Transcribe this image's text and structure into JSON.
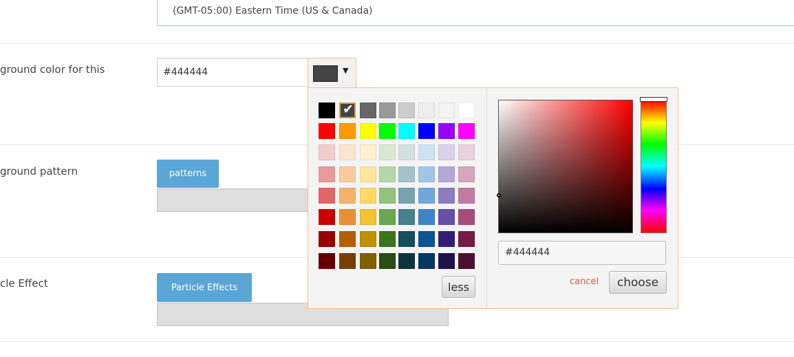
{
  "timezone": {
    "value": "(GMT-05:00) Eastern Time (US & Canada)"
  },
  "rows": {
    "bg_color_label": "ground color for this",
    "bg_pattern_label": "ground pattern",
    "particle_label": "cle Effect"
  },
  "color_field": {
    "value": "#444444",
    "swatch_color": "#444444",
    "caret": "▼"
  },
  "buttons": {
    "patterns": "patterns",
    "particle_effects": "Particle Effects"
  },
  "palette": {
    "selected_color": "#444444",
    "rows": [
      [
        "#000000",
        "#444444",
        "#666666",
        "#999999",
        "#cccccc",
        "#eeeeee",
        "#f3f3f3",
        "#ffffff"
      ],
      [
        "#ff0000",
        "#ff9900",
        "#ffff00",
        "#00ff00",
        "#00ffff",
        "#0000ff",
        "#9900ff",
        "#ff00ff"
      ],
      [
        "#f4cccc",
        "#fce5cd",
        "#fff2cc",
        "#d9ead3",
        "#d0e0e3",
        "#cfe2f3",
        "#d9d2e9",
        "#ead1dc"
      ],
      [
        "#ea9999",
        "#f9cb9c",
        "#ffe599",
        "#b6d7a8",
        "#a2c4c9",
        "#9fc5e8",
        "#b4a7d6",
        "#d5a6bd"
      ],
      [
        "#e06666",
        "#f6b26b",
        "#ffd966",
        "#93c47d",
        "#76a5af",
        "#6fa8dc",
        "#8e7cc3",
        "#c27ba0"
      ],
      [
        "#cc0000",
        "#e69138",
        "#f1c232",
        "#6aa84f",
        "#45818e",
        "#3d85c6",
        "#674ea7",
        "#a64d79"
      ],
      [
        "#990000",
        "#b45f06",
        "#bf9000",
        "#38761d",
        "#134f5c",
        "#0b5394",
        "#351c75",
        "#741b47"
      ],
      [
        "#660000",
        "#783f04",
        "#7f6000",
        "#274e13",
        "#0c343d",
        "#073763",
        "#20124d",
        "#4c1130"
      ]
    ],
    "less_label": "less",
    "hex_value": "#444444",
    "cancel_label": "cancel",
    "choose_label": "choose",
    "check_glyph": "✔"
  }
}
